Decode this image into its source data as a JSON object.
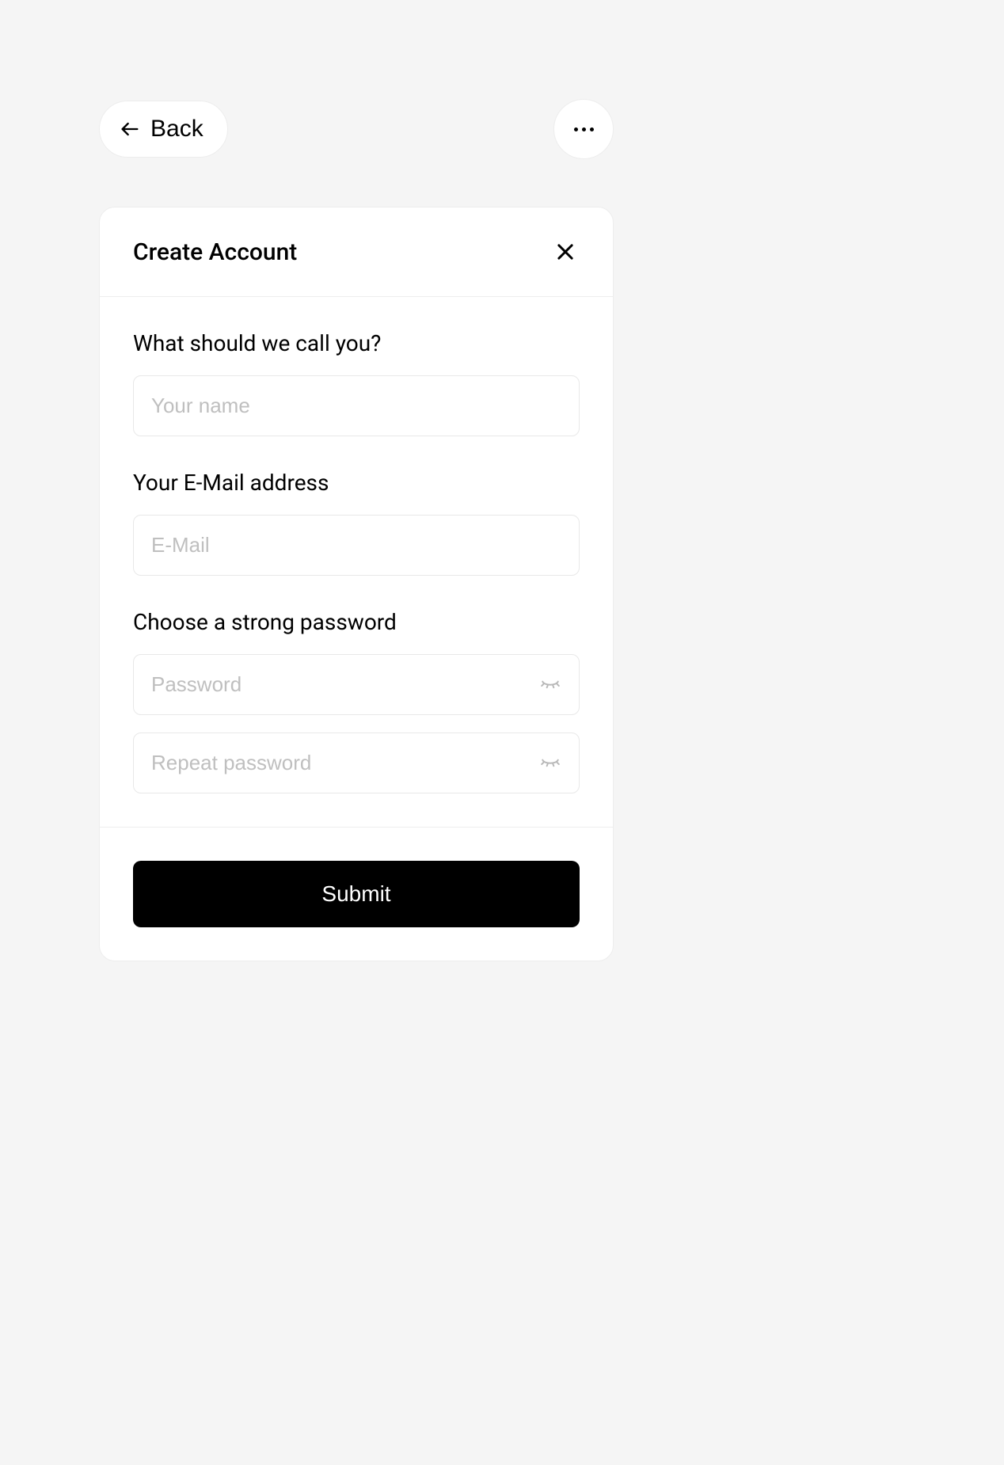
{
  "topbar": {
    "back_label": "Back"
  },
  "card": {
    "title": "Create Account"
  },
  "form": {
    "name_label": "What should we call you?",
    "name_placeholder": "Your name",
    "email_label": "Your E-Mail address",
    "email_placeholder": "E-Mail",
    "password_label": "Choose a strong password",
    "password_placeholder": "Password",
    "repeat_password_placeholder": "Repeat password"
  },
  "footer": {
    "submit_label": "Submit"
  }
}
